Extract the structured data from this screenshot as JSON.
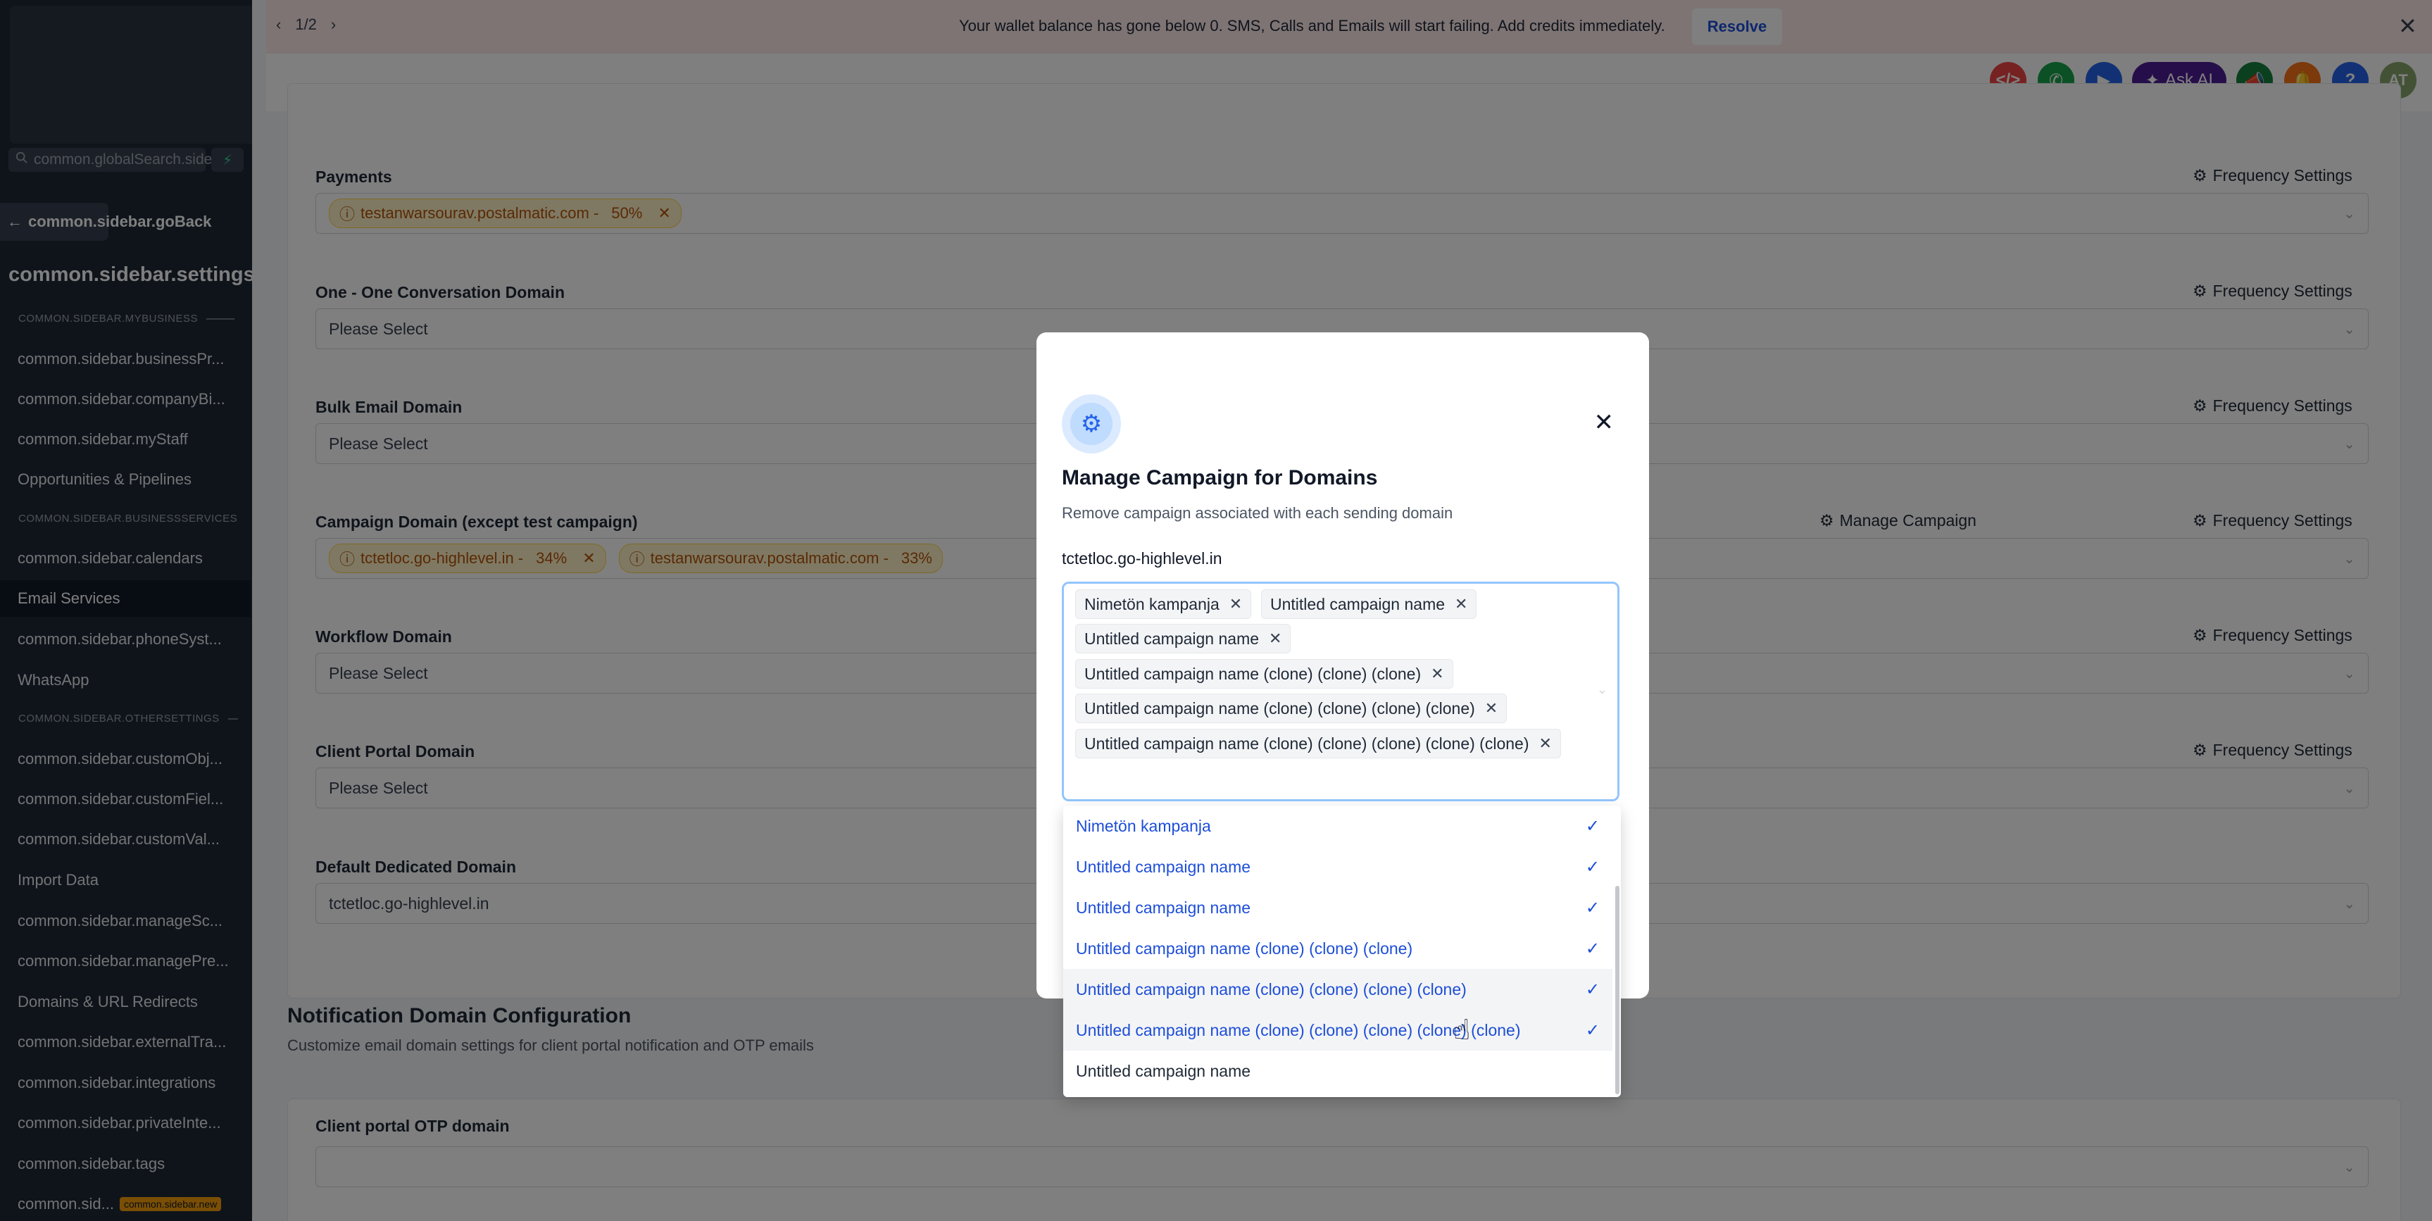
{
  "sidebar": {
    "search_placeholder": "common.globalSearch.sidebar",
    "go_back": "common.sidebar.goBack",
    "title": "common.sidebar.settings",
    "sections": {
      "mybusiness": "COMMON.SIDEBAR.MYBUSINESS",
      "businessservices": "COMMON.SIDEBAR.BUSINESSSERVICES",
      "othersettings": "COMMON.SIDEBAR.OTHERSETTINGS"
    },
    "items": [
      "common.sidebar.businessPr...",
      "common.sidebar.companyBi...",
      "common.sidebar.myStaff",
      "Opportunities & Pipelines",
      "common.sidebar.calendars",
      "Email Services",
      "common.sidebar.phoneSyst...",
      "WhatsApp",
      "common.sidebar.customObj...",
      "common.sidebar.customFiel...",
      "common.sidebar.customVal...",
      "Import Data",
      "common.sidebar.manageSc...",
      "common.sidebar.managePre...",
      "Domains & URL Redirects",
      "common.sidebar.externalTra...",
      "common.sidebar.integrations",
      "common.sidebar.privateInte...",
      "common.sidebar.tags",
      "common.sid..."
    ],
    "new_badge": "common.sidebar.new"
  },
  "banner": {
    "pager": "1/2",
    "message": "Your wallet balance has gone below 0. SMS, Calls and Emails will start failing. Add credits immediately.",
    "resolve": "Resolve"
  },
  "header": {
    "ask_ai": "Ask AI",
    "avatar_initials": "AT"
  },
  "form": {
    "frequency_settings": "Frequency Settings",
    "manage_campaign": "Manage Campaign",
    "payments": {
      "label": "Payments",
      "chips": [
        {
          "domain": "testanwarsourav.postalmatic.com -",
          "pct": "50%"
        }
      ]
    },
    "one_one": {
      "label": "One - One Conversation Domain",
      "value": "Please Select"
    },
    "bulk": {
      "label": "Bulk Email Domain",
      "value": "Please Select"
    },
    "campaign": {
      "label": "Campaign Domain (except test campaign)",
      "chips": [
        {
          "domain": "tctetloc.go-highlevel.in -",
          "pct": "34%"
        },
        {
          "domain": "testanwarsourav.postalmatic.com -",
          "pct": "33%"
        }
      ]
    },
    "workflow": {
      "label": "Workflow Domain",
      "value": "Please Select"
    },
    "client_portal": {
      "label": "Client Portal Domain",
      "value": "Please Select"
    },
    "default_dedicated": {
      "label": "Default Dedicated Domain",
      "value": "tctetloc.go-highlevel.in"
    },
    "notification": {
      "title": "Notification Domain Configuration",
      "subtitle": "Customize email domain settings for client portal notification and OTP emails",
      "otp_label": "Client portal OTP domain"
    }
  },
  "modal": {
    "title": "Manage Campaign for Domains",
    "subtitle": "Remove campaign associated with each sending domain",
    "domain": "tctetloc.go-highlevel.in",
    "tags": [
      "Nimetön kampanja",
      "Untitled campaign name",
      "Untitled campaign name",
      "Untitled campaign name (clone) (clone) (clone)",
      "Untitled campaign name (clone) (clone) (clone) (clone)",
      "Untitled campaign name (clone) (clone) (clone) (clone) (clone)"
    ],
    "options": [
      "Nimetön kampanja",
      "Untitled campaign name",
      "Untitled campaign name",
      "Untitled campaign name (clone) (clone) (clone)",
      "Untitled campaign name (clone) (clone) (clone) (clone)",
      "Untitled campaign name (clone) (clone) (clone) (clone) (clone)",
      "Untitled campaign name"
    ]
  },
  "colors": {
    "sidebar_bg": "#1f2937",
    "banner_bg": "#fde8e8",
    "accent": "#1d4ed8",
    "chip_text": "#b45309"
  }
}
